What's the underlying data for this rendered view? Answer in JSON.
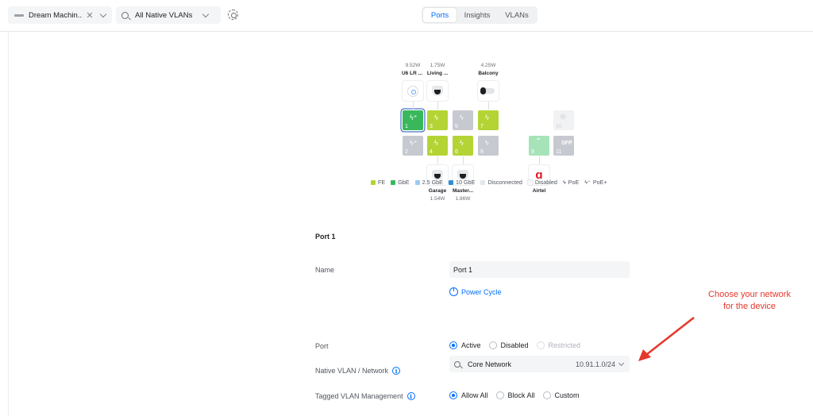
{
  "toolbar": {
    "device": "Dream Machin...",
    "clear": "✕",
    "vlan_filter": "All Native VLANs",
    "tabs": [
      "Ports",
      "Insights",
      "VLANs"
    ],
    "active_tab": "Ports"
  },
  "diagram": {
    "top_devices": [
      {
        "watt": "9.52W",
        "name": "U6 LR ...",
        "icon": "access-point-icon"
      },
      {
        "watt": "1.75W",
        "name": "Living ...",
        "icon": "dome-camera-icon"
      },
      {
        "watt": "4.25W",
        "name": "Balcony",
        "icon": "bullet-camera-icon"
      }
    ],
    "bottom_devices": [
      {
        "name": "Garage",
        "watt": "1.54W",
        "icon": "dome-camera-icon"
      },
      {
        "name": "Master...",
        "watt": "1.86W",
        "icon": "dome-camera-icon"
      },
      {
        "name": "Airtel",
        "watt": "",
        "icon": "airtel-logo"
      }
    ],
    "ports": [
      {
        "num": "1",
        "speed": "GbE",
        "poe": "PoE+",
        "selected": true
      },
      {
        "num": "2",
        "speed": "Disconnected",
        "poe": "PoE+"
      },
      {
        "num": "3",
        "speed": "FE",
        "poe": "PoE"
      },
      {
        "num": "4",
        "speed": "FE",
        "poe": "PoE"
      },
      {
        "num": "5",
        "speed": "Disconnected",
        "poe": "PoE"
      },
      {
        "num": "6",
        "speed": "FE",
        "poe": "PoE"
      },
      {
        "num": "7",
        "speed": "FE",
        "poe": "PoE"
      },
      {
        "num": "8",
        "speed": "Disconnected",
        "poe": "PoE"
      },
      {
        "num": "9",
        "speed": "GbE",
        "poe": "",
        "label": "uplink"
      },
      {
        "num": "10",
        "speed": "Disabled",
        "poe": "",
        "label": "internet"
      },
      {
        "num": "11",
        "speed": "Disconnected",
        "poe": "",
        "label": "SFP"
      }
    ],
    "sfp_label": "SFP",
    "legend": [
      {
        "label": "FE",
        "color": "#b4d435"
      },
      {
        "label": "GbE",
        "color": "#39b85b"
      },
      {
        "label": "2.5 GbE",
        "color": "#9ccaf6"
      },
      {
        "label": "10 GbE",
        "color": "#2d8fd5"
      },
      {
        "label": "Disconnected",
        "color": "#e3e5e8"
      },
      {
        "label": "Disabled",
        "color": "#f7f8f9"
      },
      {
        "label": "PoE",
        "icon": "bolt-icon"
      },
      {
        "label": "PoE+",
        "icon": "bolt-plus-icon"
      }
    ]
  },
  "port_panel": {
    "title": "Port 1",
    "name_label": "Name",
    "name_value": "Port 1",
    "power_cycle": "Power Cycle",
    "port_label": "Port",
    "port_options": [
      "Active",
      "Disabled",
      "Restricted"
    ],
    "port_selected": "Active",
    "native_vlan_label": "Native VLAN / Network",
    "network_name": "Core Network",
    "network_subnet": "10.91.1.0/24",
    "tagged_label": "Tagged VLAN Management",
    "tagged_options": [
      "Allow All",
      "Block All",
      "Custom"
    ],
    "tagged_selected": "Allow All"
  },
  "annotation": {
    "text_line1": "Choose your network",
    "text_line2": "for the device",
    "color": "#e5372b"
  }
}
